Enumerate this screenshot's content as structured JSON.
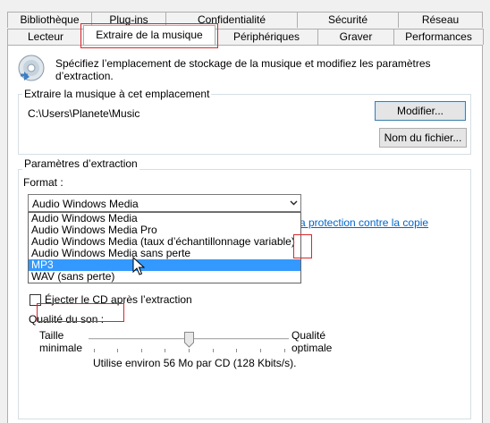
{
  "tabs": {
    "back": [
      "Bibliothèque",
      "Plug-ins",
      "Confidentialité",
      "Sécurité",
      "Réseau"
    ],
    "front": [
      "Lecteur",
      "Extraire de la musique",
      "Périphériques",
      "Graver",
      "Performances"
    ],
    "active_tab": "Extraire de la musique"
  },
  "header": {
    "icon": "cd-rip-icon",
    "description": "Spécifiez l’emplacement de stockage de la musique et modifiez les paramètres d’extraction."
  },
  "location": {
    "legend": "Extraire la musique à cet emplacement",
    "path": "C:\\Users\\Planete\\Music",
    "modify_button": "Modifier...",
    "filename_button": "Nom du fichier..."
  },
  "settings": {
    "legend": "Paramètres d’extraction",
    "format_label": "Format :",
    "format_selected": "Audio Windows Media",
    "format_options": [
      "Audio Windows Media",
      "Audio Windows Media Pro",
      "Audio Windows Media (taux d’échantillonnage variable)",
      "Audio Windows Media sans perte",
      "MP3",
      "WAV (sans perte)"
    ],
    "highlighted_option": "MP3",
    "link_partial": "a protection contre la copie",
    "eject_label": "Éjecter le CD après l’extraction",
    "eject_checked": false,
    "quality_label": "Qualité du son :",
    "quality_min": "Taille minimale",
    "quality_max": "Qualité optimale",
    "quality_level": 0.5,
    "quality_info": "Utilise environ 56 Mo par CD (128 Kbits/s)."
  },
  "colors": {
    "highlight": "#3399ff",
    "annotation": "#d9262b",
    "link": "#0066cc"
  }
}
